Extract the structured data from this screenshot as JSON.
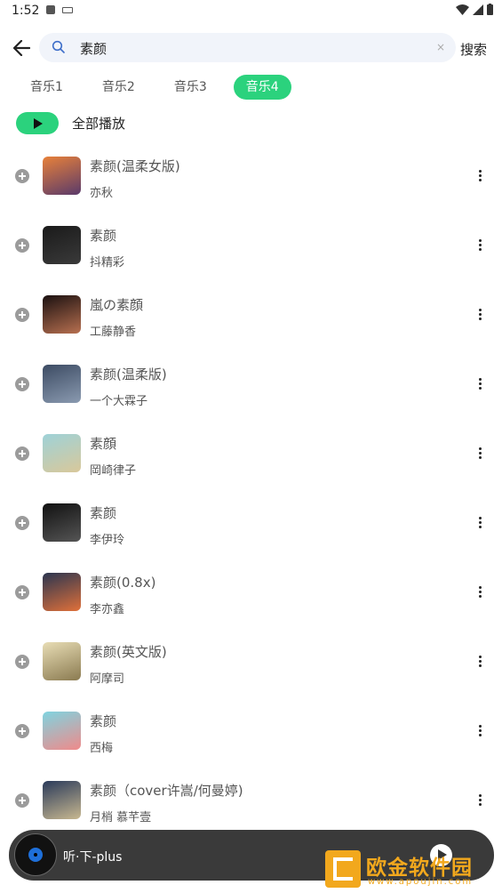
{
  "status_bar": {
    "time": "1:52"
  },
  "search": {
    "value": "素颜",
    "button_label": "搜索",
    "clear_label": "×"
  },
  "tabs": [
    {
      "label": "音乐1",
      "active": false
    },
    {
      "label": "音乐2",
      "active": false
    },
    {
      "label": "音乐3",
      "active": false
    },
    {
      "label": "音乐4",
      "active": true
    }
  ],
  "play_all": {
    "label": "全部播放"
  },
  "songs": [
    {
      "title": "素颜(温柔女版)",
      "artist": "亦秋",
      "cover_colors": [
        "#e8813a",
        "#5a3a6a"
      ]
    },
    {
      "title": "素颜",
      "artist": "抖精彩",
      "cover_colors": [
        "#1a1a1a",
        "#3a3a3a"
      ]
    },
    {
      "title": "嵐の素顔",
      "artist": "工藤静香",
      "cover_colors": [
        "#1a1010",
        "#b87050"
      ]
    },
    {
      "title": "素颜(温柔版)",
      "artist": "一个大霖子",
      "cover_colors": [
        "#3c4b63",
        "#8a9ab0"
      ]
    },
    {
      "title": "素顔",
      "artist": "岡崎律子",
      "cover_colors": [
        "#9ed2d8",
        "#d9c89a"
      ]
    },
    {
      "title": "素颜",
      "artist": "李伊玲",
      "cover_colors": [
        "#111111",
        "#555555"
      ]
    },
    {
      "title": "素颜(0.8x)",
      "artist": "李亦鑫",
      "cover_colors": [
        "#2a3550",
        "#e0703a"
      ]
    },
    {
      "title": "素颜(英文版)",
      "artist": "阿摩司",
      "cover_colors": [
        "#e8ddb5",
        "#8a7a50"
      ]
    },
    {
      "title": "素颜",
      "artist": "西梅",
      "cover_colors": [
        "#7fd4e0",
        "#f08a8a"
      ]
    },
    {
      "title": "素颜（cover许嵩/何曼婷)",
      "artist": "月梢 慕芊壹",
      "cover_colors": [
        "#2a3a5a",
        "#c8b890"
      ]
    }
  ],
  "player": {
    "title": "听·下-plus"
  },
  "watermark": {
    "text": "欧金软件园",
    "url": "www.apoujin.com"
  },
  "colors": {
    "accent": "#2bd27d",
    "search_bg": "#f1f4fa",
    "player_bg": "#3a3a3a"
  }
}
